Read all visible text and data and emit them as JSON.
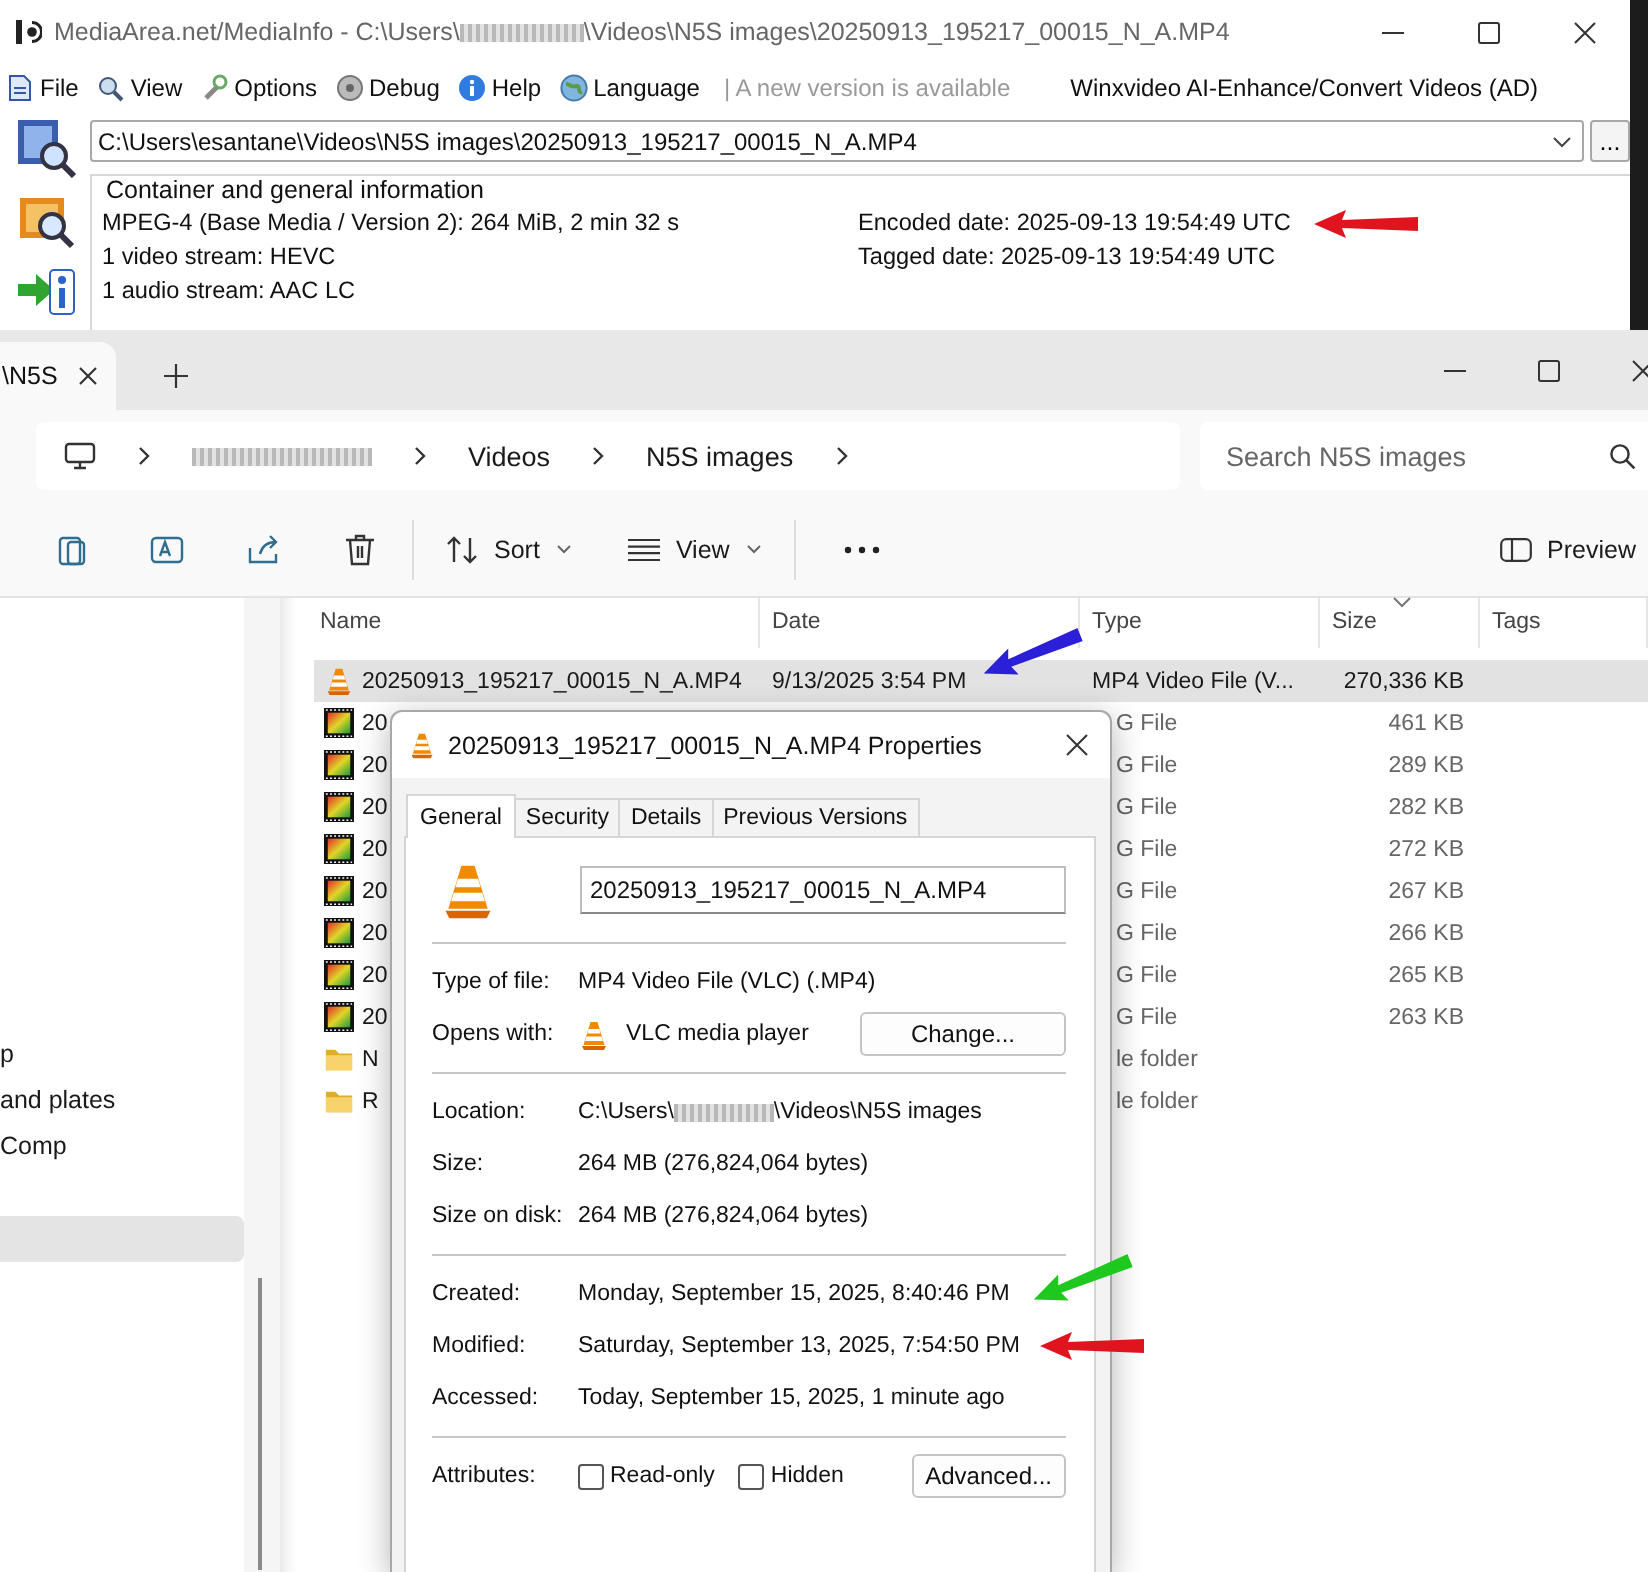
{
  "mediainfo": {
    "title_parts": [
      "MediaArea.net/MediaInfo - C:\\Users\\",
      "\\Videos\\N5S images\\20250913_195217_00015_N_A.MP4"
    ],
    "menu": [
      {
        "label": "File"
      },
      {
        "label": "View"
      },
      {
        "label": "Options"
      },
      {
        "label": "Debug"
      },
      {
        "label": "Help"
      },
      {
        "label": "Language"
      }
    ],
    "notice": "| A new version is available",
    "ad_link": "Winxvideo AI-Enhance/Convert Videos (AD)",
    "file_path": "C:\\Users\\esantane\\Videos\\N5S images\\20250913_195217_00015_N_A.MP4",
    "browse_button": "...",
    "info_group": {
      "title": "Container and general information",
      "left_lines": [
        {
          "text": "MPEG-4 (Base Media / Version 2): 264 MiB, 2 min 32 s"
        },
        {
          "text": "1 video stream: HEVC"
        },
        {
          "text": "1 audio stream: AAC LC"
        }
      ],
      "right_lines": [
        {
          "text": "Encoded date: 2025-09-13 19:54:49 UTC",
          "arrow": {
            "kind": "level",
            "color": "#e0141e"
          }
        },
        {
          "text": "Tagged date: 2025-09-13 19:54:49 UTC"
        }
      ]
    }
  },
  "explorer": {
    "tab": {
      "label": "\\N5S"
    },
    "breadcrumb": [
      {
        "kind": "blurred"
      },
      {
        "kind": "text",
        "label": "Videos"
      },
      {
        "kind": "text",
        "label": "N5S images"
      }
    ],
    "search": {
      "placeholder": "Search N5S images"
    },
    "toolbar": {
      "sort": "Sort",
      "view": "View",
      "preview": "Preview"
    },
    "nav_items": [
      {
        "label": "p",
        "selected": false
      },
      {
        "label": "and plates",
        "selected": false
      },
      {
        "label": "Comp",
        "selected": false
      },
      {
        "selected": true
      }
    ],
    "columns": [
      {
        "label": "Name",
        "sorted": false
      },
      {
        "label": "Date",
        "sorted": false
      },
      {
        "label": "Type",
        "sorted": false
      },
      {
        "label": "Size",
        "sorted": true
      },
      {
        "label": "Tags",
        "sorted": false
      }
    ],
    "rows": [
      {
        "kind": "video",
        "name": "20250913_195217_00015_N_A.MP4",
        "date": "9/13/2025 3:54 PM",
        "type": "MP4 Video File (V...",
        "size": "270,336 KB",
        "selected": true,
        "arrow": {
          "kind": "slanted",
          "color": "#2b1fd8"
        }
      },
      {
        "kind": "image",
        "name": "20",
        "type": "G File",
        "size": "461 KB",
        "selected": false
      },
      {
        "kind": "image",
        "name": "20",
        "type": "G File",
        "size": "289 KB",
        "selected": false
      },
      {
        "kind": "image",
        "name": "20",
        "type": "G File",
        "size": "282 KB",
        "selected": false
      },
      {
        "kind": "image",
        "name": "20",
        "type": "G File",
        "size": "272 KB",
        "selected": false
      },
      {
        "kind": "image",
        "name": "20",
        "type": "G File",
        "size": "267 KB",
        "selected": false
      },
      {
        "kind": "image",
        "name": "20",
        "type": "G File",
        "size": "266 KB",
        "selected": false
      },
      {
        "kind": "image",
        "name": "20",
        "type": "G File",
        "size": "265 KB",
        "selected": false
      },
      {
        "kind": "image",
        "name": "20",
        "type": "G File",
        "size": "263 KB",
        "selected": false
      },
      {
        "kind": "folder",
        "name": "N",
        "type": "le folder",
        "selected": false
      },
      {
        "kind": "folder",
        "name": "R",
        "type": "le folder",
        "selected": false
      }
    ]
  },
  "properties": {
    "title": "20250913_195217_00015_N_A.MP4 Properties",
    "tabs": [
      {
        "label": "General",
        "selected": true
      },
      {
        "label": "Security",
        "selected": false
      },
      {
        "label": "Details",
        "selected": false
      },
      {
        "label": "Previous Versions",
        "selected": false
      }
    ],
    "file_name": "20250913_195217_00015_N_A.MP4",
    "sections": [
      [
        {
          "kind": "text",
          "label": "Type of file:",
          "value": "MP4 Video File (VLC) (.MP4)"
        },
        {
          "kind": "opens",
          "label": "Opens with:",
          "value": "VLC media player",
          "button": "Change..."
        }
      ],
      [
        {
          "kind": "location",
          "label": "Location:",
          "value_parts": [
            "C:\\Users\\",
            "\\Videos\\N5S images"
          ]
        },
        {
          "kind": "text",
          "label": "Size:",
          "value": "264 MB (276,824,064 bytes)"
        },
        {
          "kind": "text",
          "label": "Size on disk:",
          "value": "264 MB (276,824,064 bytes)"
        }
      ],
      [
        {
          "kind": "text",
          "label": "Created:",
          "value": "Monday, September 15, 2025, 8:40:46 PM",
          "arrow": {
            "kind": "slanted",
            "color": "#1ec81e"
          }
        },
        {
          "kind": "text",
          "label": "Modified:",
          "value": "Saturday, September 13, 2025, 7:54:50 PM",
          "arrow": {
            "kind": "level",
            "color": "#e0141e"
          }
        },
        {
          "kind": "text",
          "label": "Accessed:",
          "value": "Today, September 15, 2025, 1 minute ago"
        }
      ],
      [
        {
          "kind": "attributes",
          "label": "Attributes:",
          "checkboxes": [
            {
              "label": "Read-only",
              "checked": false
            },
            {
              "label": "Hidden",
              "checked": false
            }
          ],
          "button": "Advanced..."
        }
      ]
    ]
  }
}
